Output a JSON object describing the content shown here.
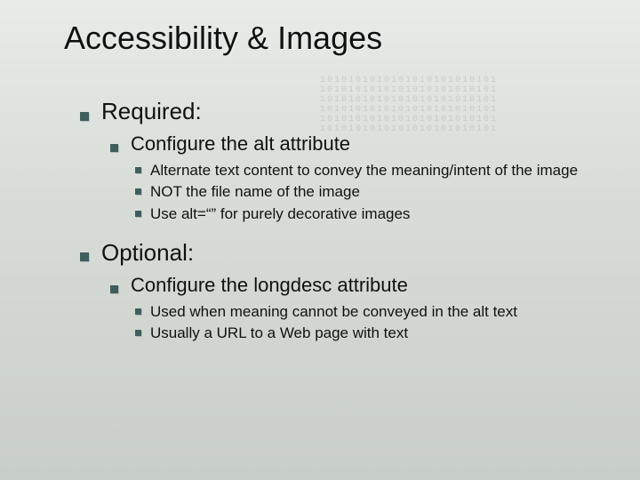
{
  "slide": {
    "title": "Accessibility & Images",
    "sections": [
      {
        "heading": "Required:",
        "sub": {
          "heading": "Configure the alt attribute",
          "points": [
            "Alternate text content to convey the meaning/intent of the image",
            "NOT the file name of the image",
            "Use alt=“” for purely decorative images"
          ]
        }
      },
      {
        "heading": "Optional:",
        "sub": {
          "heading": "Configure the longdesc attribute",
          "points": [
            "Used when meaning cannot be conveyed in the alt text",
            "Usually a URL to a Web page with text"
          ]
        }
      }
    ]
  },
  "texture_line": "1010101010101010101010101"
}
